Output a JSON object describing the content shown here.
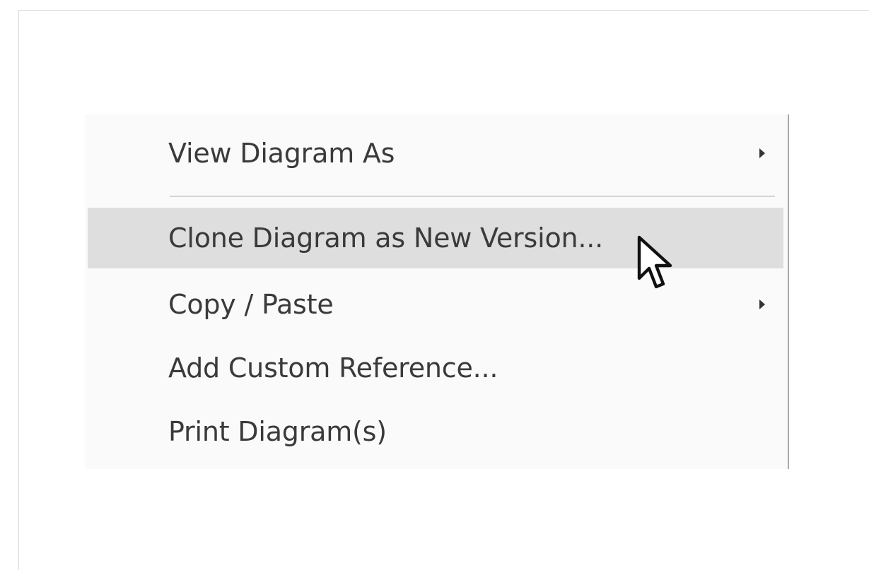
{
  "menu": {
    "items": [
      {
        "label": "View Diagram As",
        "has_submenu": true,
        "highlighted": false
      },
      {
        "label": "Clone Diagram as New Version...",
        "has_submenu": false,
        "highlighted": true
      },
      {
        "label": "Copy / Paste",
        "has_submenu": true,
        "highlighted": false
      },
      {
        "label": "Add Custom Reference...",
        "has_submenu": false,
        "highlighted": false
      },
      {
        "label": "Print Diagram(s)",
        "has_submenu": false,
        "highlighted": false
      }
    ]
  },
  "icons": {
    "submenu_arrow": "chevron-right-icon",
    "pointer": "mouse-cursor-icon"
  },
  "colors": {
    "menu_background": "#fafafa",
    "highlight": "#dedede",
    "text": "#3a3a3a"
  }
}
